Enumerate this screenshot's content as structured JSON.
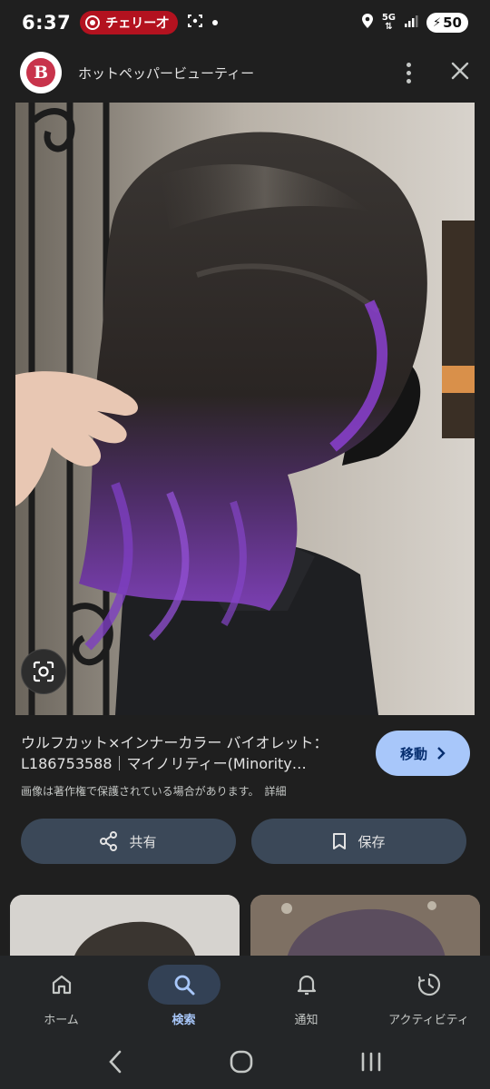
{
  "status_bar": {
    "time": "6:37",
    "notification_text": "チェリー才",
    "network": "5G",
    "battery": "50"
  },
  "header": {
    "site_name": "ホットペッパービューティー",
    "logo_letter": "B"
  },
  "result": {
    "title_line1": "ウルフカット×インナーカラー バイオレット：",
    "title_line2": "L186753588｜マイノリティー(Minority…",
    "visit_label": "移動",
    "copyright_notice": "画像は著作権で保護されている場合があります。",
    "details_link": "詳細",
    "share_label": "共有",
    "save_label": "保存"
  },
  "bottom_nav": {
    "items": [
      {
        "label": "ホーム",
        "icon": "home-icon",
        "active": false
      },
      {
        "label": "検索",
        "icon": "search-icon",
        "active": true
      },
      {
        "label": "通知",
        "icon": "bell-icon",
        "active": false
      },
      {
        "label": "アクティビティ",
        "icon": "activity-icon",
        "active": false
      }
    ]
  },
  "colors": {
    "background": "#1f1f1f",
    "accent": "#a8c7fa",
    "button_bg": "#3b4858",
    "notification_pill": "#b3121f",
    "brand": "#c8334b"
  }
}
